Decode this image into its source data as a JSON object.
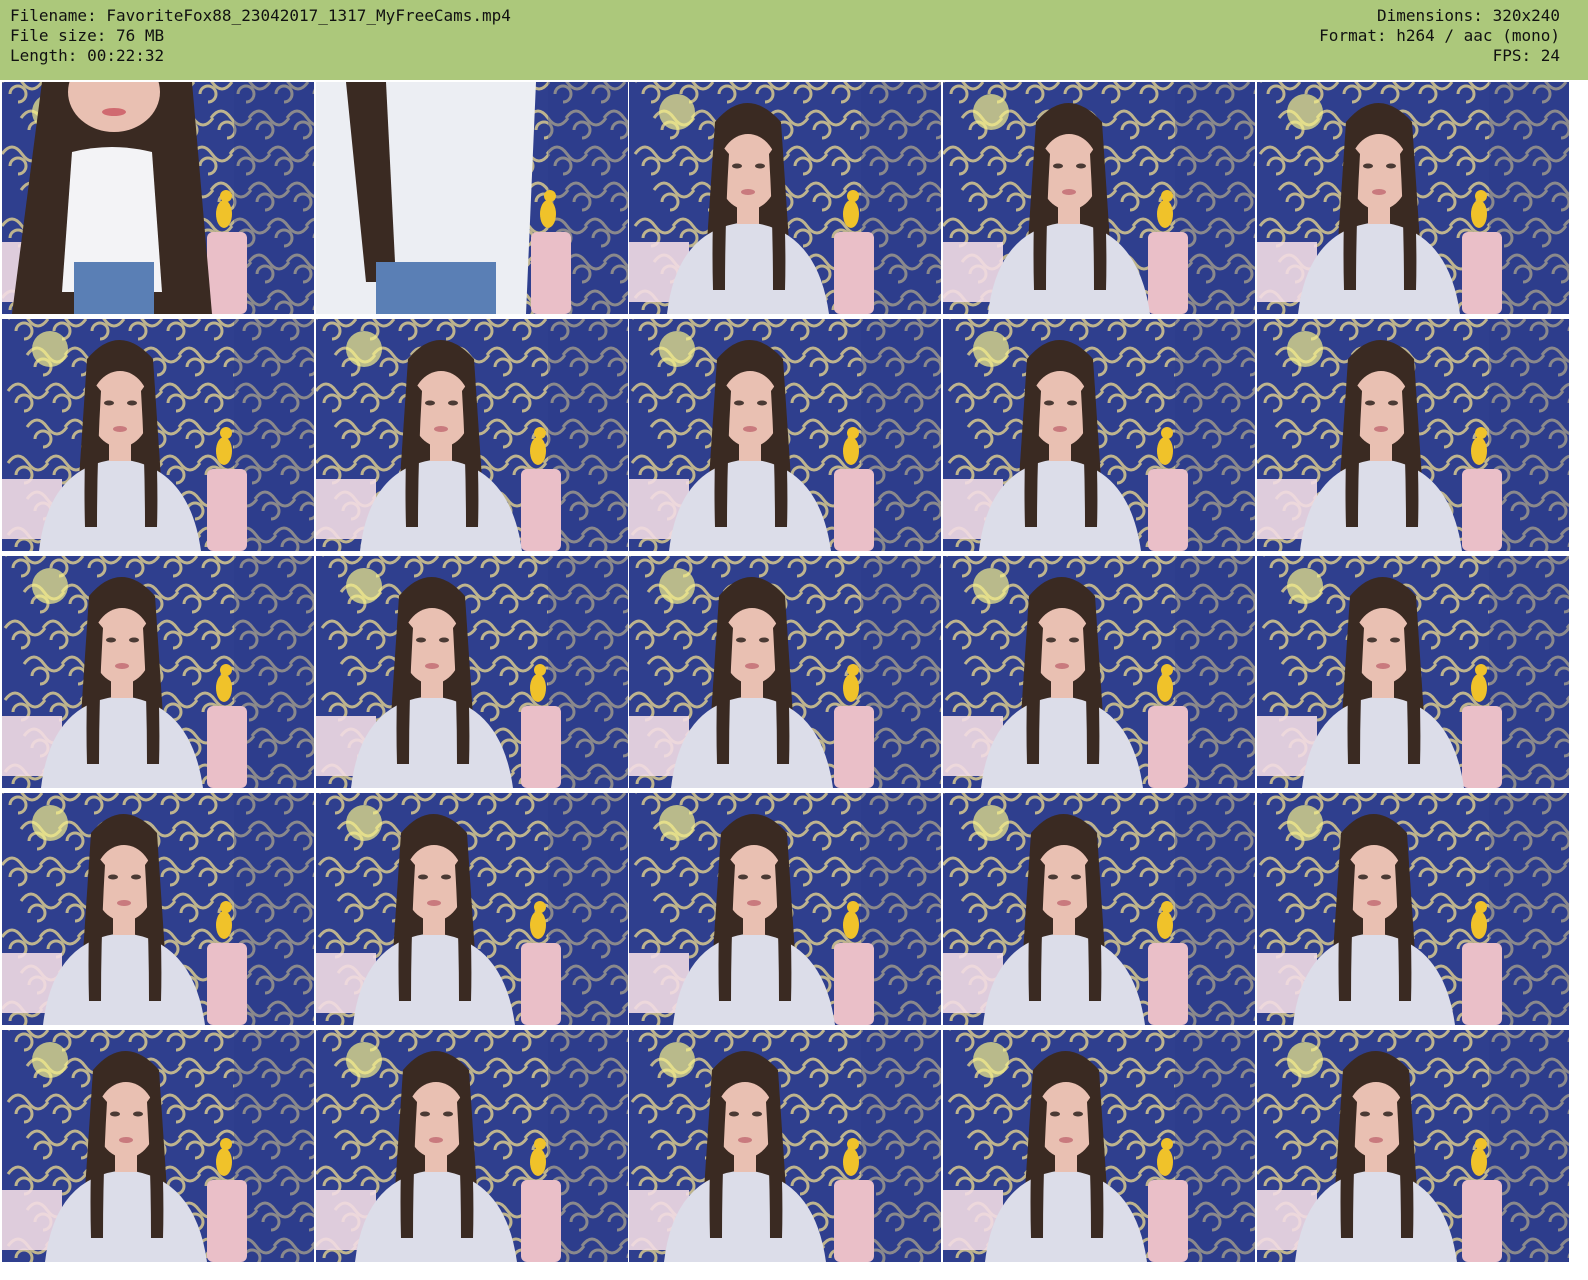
{
  "header": {
    "left": [
      "Filename: FavoriteFox88_23042017_1317_MyFreeCams.mp4",
      "File size: 76 MB",
      "Length: 00:22:32"
    ],
    "right": [
      "Dimensions: 320x240",
      "Format: h264 / aac (mono)",
      "FPS: 24"
    ]
  },
  "colors": {
    "header_bg": "#acc87b",
    "wallpaper_blue": "#2f3f8e",
    "wallpaper_pattern": "#d8c98f",
    "sweater": "#dcdde9",
    "hair": "#3a2a22",
    "skin": "#e9c0b2",
    "pink_item": "#eabfc8",
    "yellow_toy": "#f0c22a"
  },
  "thumbnails": {
    "rows": 5,
    "cols": 5,
    "frames": [
      {
        "variant": "closeup"
      },
      {
        "variant": "leaning"
      },
      {
        "variant": "seated"
      },
      {
        "variant": "seated"
      },
      {
        "variant": "seated"
      },
      {
        "variant": "seated"
      },
      {
        "variant": "seated"
      },
      {
        "variant": "seated"
      },
      {
        "variant": "seated"
      },
      {
        "variant": "seated"
      },
      {
        "variant": "seated"
      },
      {
        "variant": "seated"
      },
      {
        "variant": "seated"
      },
      {
        "variant": "seated"
      },
      {
        "variant": "seated"
      },
      {
        "variant": "seated"
      },
      {
        "variant": "seated"
      },
      {
        "variant": "seated"
      },
      {
        "variant": "seated"
      },
      {
        "variant": "seated"
      },
      {
        "variant": "seated"
      },
      {
        "variant": "seated"
      },
      {
        "variant": "seated"
      },
      {
        "variant": "seated"
      },
      {
        "variant": "seated"
      }
    ]
  }
}
